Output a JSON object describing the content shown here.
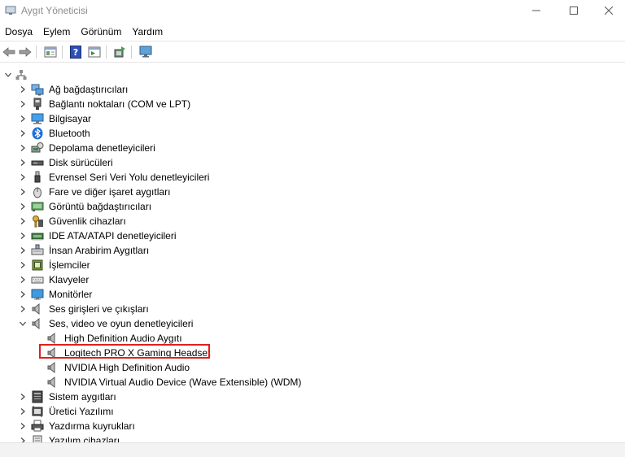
{
  "window": {
    "title": "Aygıt Yöneticisi"
  },
  "menu": [
    "Dosya",
    "Eylem",
    "Görünüm",
    "Yardım"
  ],
  "toolbar": {
    "buttons": [
      "back-arrow-icon",
      "forward-arrow-icon",
      "properties-icon",
      "help-icon",
      "view-icon",
      "update-driver-icon",
      "monitor-scan-icon"
    ]
  },
  "tree": {
    "root_icon": "computer-tree-root-icon",
    "categories": [
      {
        "label": "Ağ bağdaştırıcıları",
        "icon": "network-adapter-icon"
      },
      {
        "label": "Bağlantı noktaları (COM ve LPT)",
        "icon": "port-icon"
      },
      {
        "label": "Bilgisayar",
        "icon": "computer-icon"
      },
      {
        "label": "Bluetooth",
        "icon": "bluetooth-icon"
      },
      {
        "label": "Depolama denetleyicileri",
        "icon": "storage-controller-icon"
      },
      {
        "label": "Disk sürücüleri",
        "icon": "disk-drive-icon"
      },
      {
        "label": "Evrensel Seri Veri Yolu denetleyicileri",
        "icon": "usb-icon"
      },
      {
        "label": "Fare ve diğer işaret aygıtları",
        "icon": "mouse-icon"
      },
      {
        "label": "Görüntü bağdaştırıcıları",
        "icon": "display-adapter-icon"
      },
      {
        "label": "Güvenlik cihazları",
        "icon": "security-device-icon"
      },
      {
        "label": "IDE ATA/ATAPI denetleyicileri",
        "icon": "ide-controller-icon"
      },
      {
        "label": "İnsan Arabirim Aygıtları",
        "icon": "hid-icon"
      },
      {
        "label": "İşlemciler",
        "icon": "processor-icon"
      },
      {
        "label": "Klavyeler",
        "icon": "keyboard-icon"
      },
      {
        "label": "Monitörler",
        "icon": "monitor-icon"
      },
      {
        "label": "Ses girişleri ve çıkışları",
        "icon": "speaker-icon"
      },
      {
        "label": "Ses, video ve oyun denetleyicileri",
        "icon": "speaker-icon",
        "expanded": true
      }
    ],
    "sound_children": [
      "High Definition Audio Aygıtı",
      "Logitech PRO X Gaming Headset",
      "NVIDIA High Definition Audio",
      "NVIDIA Virtual Audio Device (Wave Extensible) (WDM)"
    ],
    "categories_after": [
      {
        "label": "Sistem aygıtları",
        "icon": "system-device-icon"
      },
      {
        "label": "Üretici Yazılımı",
        "icon": "firmware-icon"
      },
      {
        "label": "Yazdırma kuyrukları",
        "icon": "printer-icon"
      },
      {
        "label": "Yazılım cihazları",
        "icon": "software-device-icon"
      }
    ]
  },
  "highlight": {
    "label": "Logitech PRO X Gaming Headset",
    "color": "#e0201c"
  }
}
